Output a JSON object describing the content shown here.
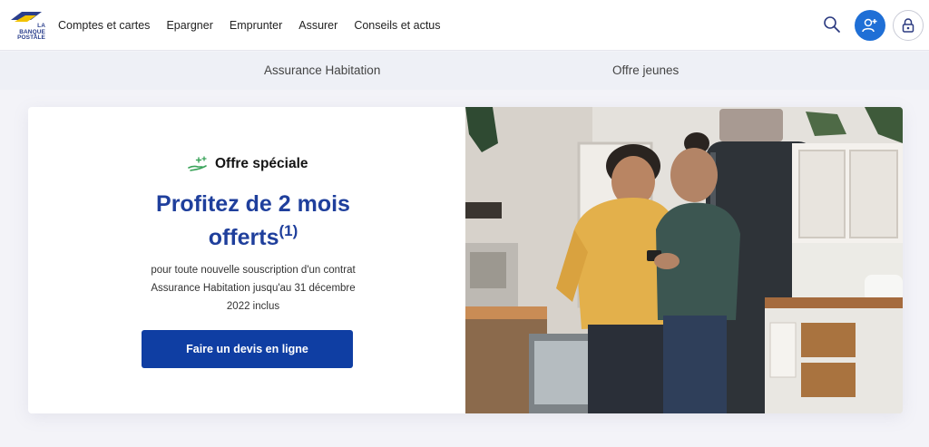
{
  "header": {
    "logo_line1": "LA",
    "logo_line2": "BANQUE",
    "logo_line3": "POSTALE",
    "nav": [
      "Comptes et cartes",
      "Epargner",
      "Emprunter",
      "Assurer",
      "Conseils et actus"
    ]
  },
  "subnav": {
    "items": [
      "Assurance Habitation",
      "Offre jeunes"
    ]
  },
  "promo": {
    "badge": "Offre spéciale",
    "headline_line1": "Profitez de 2 mois",
    "headline_line2": "offerts",
    "headline_sup": "(1)",
    "desc_line1": "pour toute nouvelle souscription d'un contrat",
    "desc_line2": "Assurance Habitation jusqu'au 31 décembre",
    "desc_line3": "2022 inclus",
    "cta": "Faire un devis en ligne"
  },
  "colors": {
    "brand_blue": "#0f3ea3",
    "headline_blue": "#1f3f9c",
    "account_blue": "#1f6fd6",
    "badge_green": "#3aa35a"
  },
  "icons": {
    "logo": "la-banque-postale-logo",
    "search": "search-icon",
    "account": "add-user-icon",
    "secure": "lock-icon",
    "badge": "gift-hand-icon"
  }
}
